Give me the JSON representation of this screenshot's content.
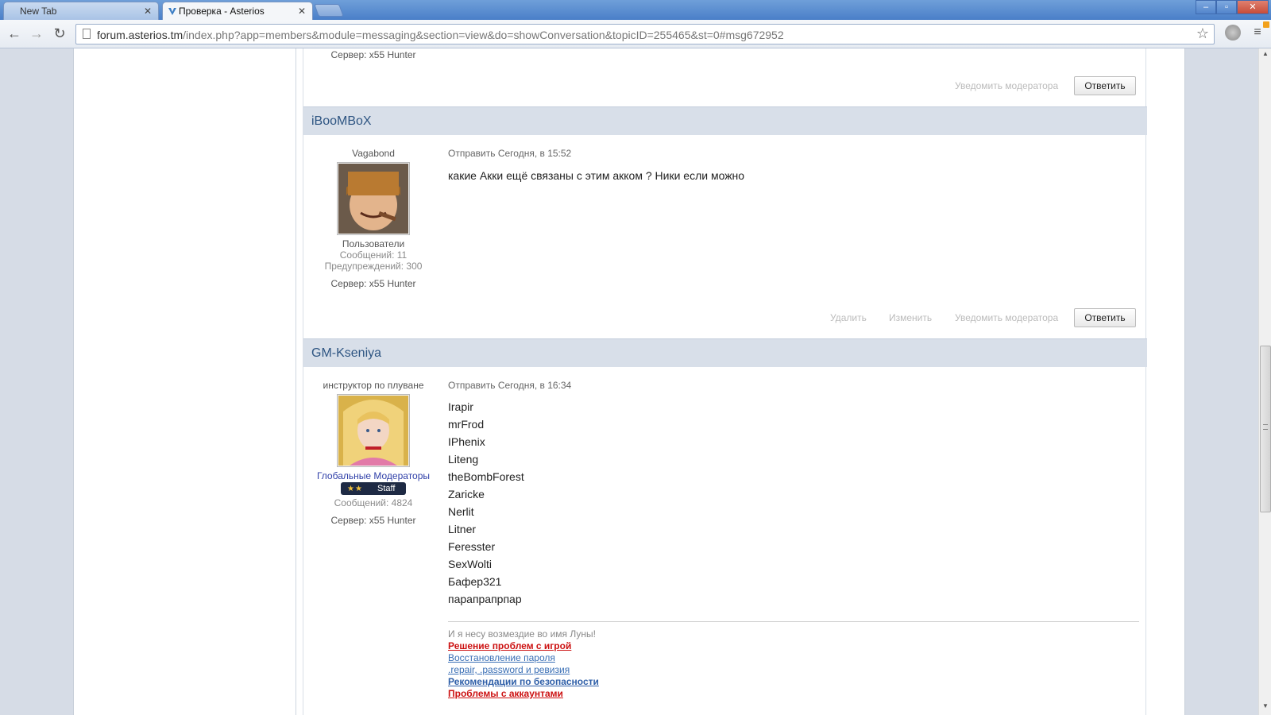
{
  "browser": {
    "tabs": [
      {
        "title": "New Tab"
      },
      {
        "title": "Проверка - Asterios"
      }
    ],
    "url_host": "forum.asterios.tm",
    "url_path": "/index.php?app=members&module=messaging&section=view&do=showConversation&topicID=255465&st=0#msg672952",
    "window_buttons": {
      "minimize": "–",
      "maximize": "▫",
      "close": "✕"
    }
  },
  "prev_post": {
    "server": "Сервер: x55 Hunter",
    "report_label": "Уведомить модератора",
    "reply_label": "Ответить"
  },
  "post1": {
    "author": "iBooMBoX",
    "title": "Vagabond",
    "group": "Пользователи",
    "posts": "Сообщений: 11",
    "warnings": "Предупреждений: 300",
    "server": "Сервер: x55 Hunter",
    "date": "Отправить Сегодня, в 15:52",
    "body": "какие Акки ещё связаны с этим акком ? Ники если можно",
    "delete_label": "Удалить",
    "edit_label": "Изменить",
    "report_label": "Уведомить модератора",
    "reply_label": "Ответить"
  },
  "post2": {
    "author": "GM-Kseniya",
    "title": "инструктор по плуване",
    "group": "Глобальные Модераторы",
    "badge_stars": "★★",
    "badge_label": "Staff",
    "posts": "Сообщений: 4824",
    "server": "Сервер: x55 Hunter",
    "date": "Отправить Сегодня, в 16:34",
    "lines": [
      "Irapir",
      "mrFrod",
      "IPhenix",
      "Liteng",
      "theBombForest",
      "Zaricke",
      "Nerlit",
      "Litner",
      "Feresster",
      "SexWolti",
      "Бафер321",
      "парапрапрпар"
    ],
    "signature": {
      "motto": "И я несу возмездие во имя Луны!",
      "links": [
        {
          "text": "Решение проблем с игрой",
          "color": "#cc1111",
          "bold": true
        },
        {
          "text": "Восстановление пароля",
          "color": "#3a6fb5",
          "bold": false
        },
        {
          "text": ".repair, .password и ревизия",
          "color": "#3a6fb5",
          "bold": false
        },
        {
          "text": "Рекомендации по безопасности",
          "color": "#2f5fa8",
          "bold": true
        },
        {
          "text": "Проблемы с аккаунтами",
          "color": "#cc1111",
          "bold": true
        }
      ]
    }
  },
  "icons": {
    "back": "←",
    "forward": "→",
    "reload": "↻",
    "star": "☆",
    "menu": "≡",
    "tab_close": "✕",
    "scroll_up": "▲",
    "scroll_down": "▼"
  },
  "colors": {
    "author_link": "#2e5582",
    "post_header_bg": "#d8dfe9",
    "moderator_group": "#2f3fa8",
    "signature_red": "#cc1111",
    "signature_blue": "#3a6fb5"
  }
}
